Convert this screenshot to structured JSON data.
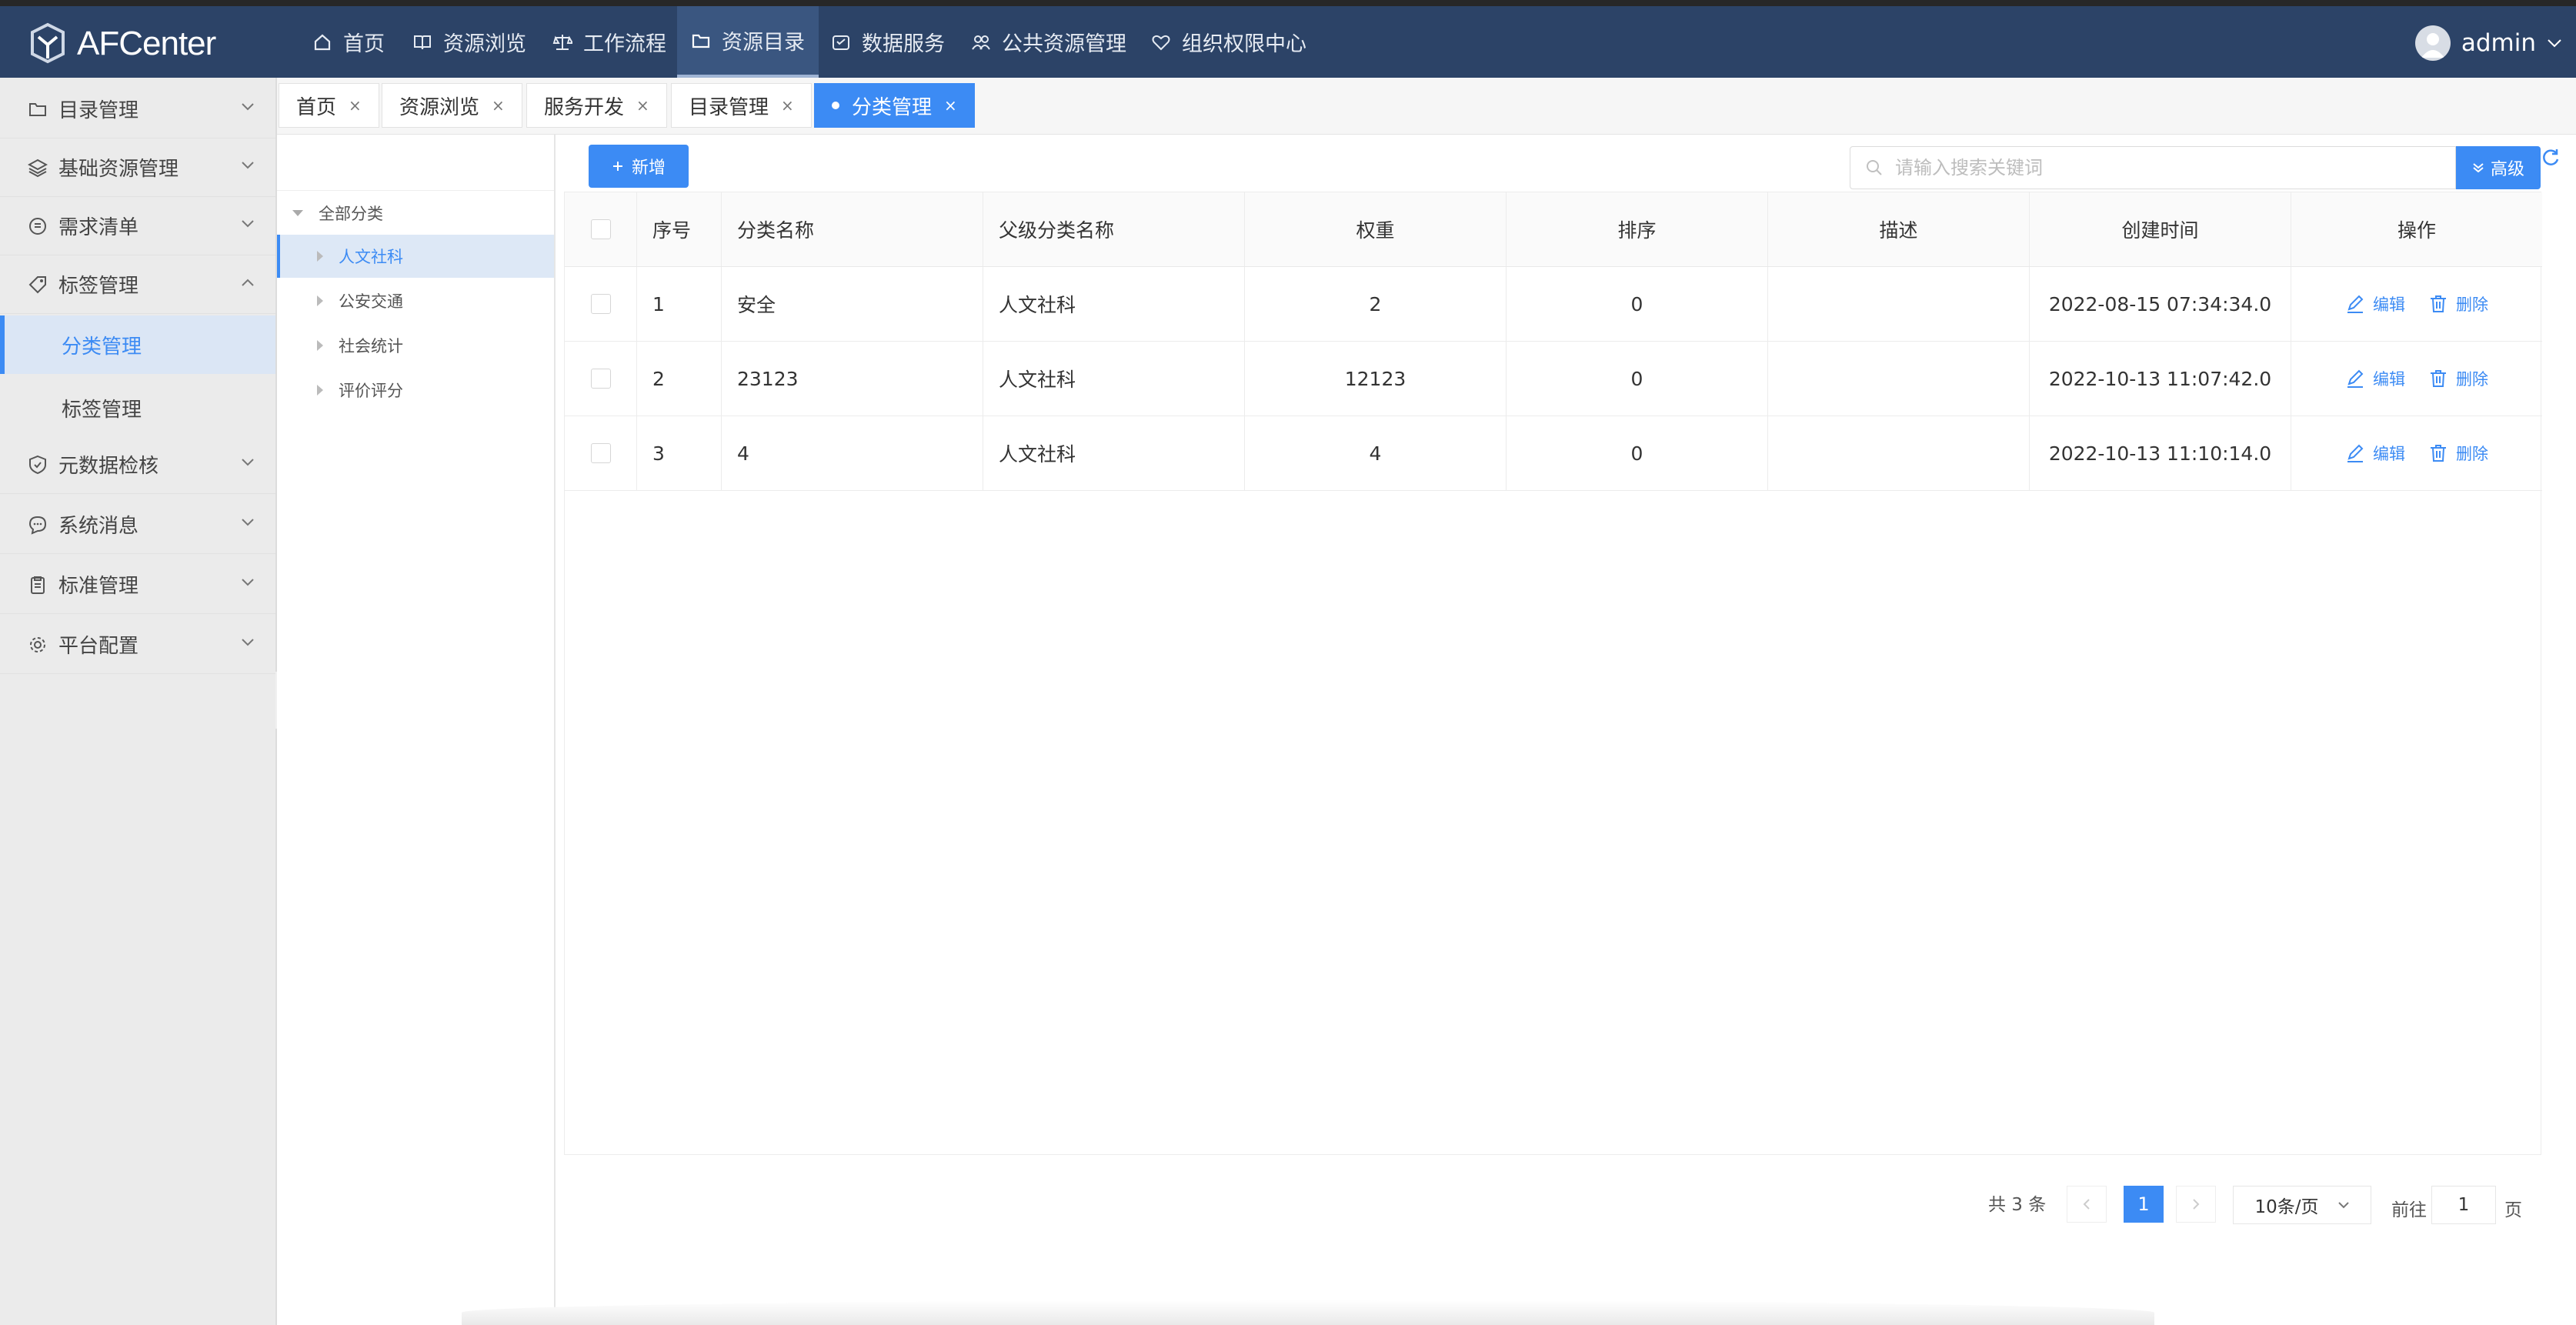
{
  "app": {
    "logo_text": "AFCenter"
  },
  "topnav": [
    {
      "label": "首页",
      "icon": "home-icon"
    },
    {
      "label": "资源浏览",
      "icon": "book-icon"
    },
    {
      "label": "工作流程",
      "icon": "scale-icon"
    },
    {
      "label": "资源目录",
      "icon": "folder-icon",
      "active": true
    },
    {
      "label": "数据服务",
      "icon": "box-icon"
    },
    {
      "label": "公共资源管理",
      "icon": "people-icon"
    },
    {
      "label": "组织权限中心",
      "icon": "heart-shield-icon"
    }
  ],
  "user": {
    "name": "admin"
  },
  "sidebar": {
    "items": [
      {
        "label": "目录管理",
        "icon": "folder-icon"
      },
      {
        "label": "基础资源管理",
        "icon": "layers-icon"
      },
      {
        "label": "需求清单",
        "icon": "list-icon"
      },
      {
        "label": "标签管理",
        "icon": "tag-icon",
        "expanded": true,
        "children": [
          {
            "label": "分类管理",
            "active": true
          },
          {
            "label": "标签管理"
          }
        ]
      },
      {
        "label": "元数据检核",
        "icon": "shield-check-icon"
      },
      {
        "label": "系统消息",
        "icon": "chat-icon"
      },
      {
        "label": "标准管理",
        "icon": "clipboard-icon"
      },
      {
        "label": "平台配置",
        "icon": "gear-icon"
      }
    ]
  },
  "tabs": [
    {
      "label": "首页"
    },
    {
      "label": "资源浏览"
    },
    {
      "label": "服务开发"
    },
    {
      "label": "目录管理"
    },
    {
      "label": "分类管理",
      "active": true
    }
  ],
  "tree": {
    "root": "全部分类",
    "children": [
      "人文社科",
      "公安交通",
      "社会统计",
      "评价评分"
    ],
    "selected": "人文社科"
  },
  "toolbar": {
    "add_label": "新增",
    "search_placeholder": "请输入搜索关键词",
    "advanced_label": "高级"
  },
  "table": {
    "columns": [
      "序号",
      "分类名称",
      "父级分类名称",
      "权重",
      "排序",
      "描述",
      "创建时间",
      "操作"
    ],
    "rows": [
      {
        "index": "1",
        "name": "安全",
        "parent": "人文社科",
        "weight": "2",
        "order": "0",
        "desc": "",
        "created": "2022-08-15 07:34:34.0"
      },
      {
        "index": "2",
        "name": "23123",
        "parent": "人文社科",
        "weight": "12123",
        "order": "0",
        "desc": "",
        "created": "2022-10-13 11:07:42.0"
      },
      {
        "index": "3",
        "name": "4",
        "parent": "人文社科",
        "weight": "4",
        "order": "0",
        "desc": "",
        "created": "2022-10-13 11:10:14.0"
      }
    ],
    "edit_label": "编辑",
    "delete_label": "删除"
  },
  "pagination": {
    "total_text": "共 3 条",
    "current_page": "1",
    "page_size": "10条/页",
    "goto_label": "前往",
    "goto_value": "1",
    "page_suffix": "页"
  },
  "colors": {
    "topbar": "#2c4367",
    "accent": "#3c8bf4",
    "sidebar": "#ebebeb"
  }
}
